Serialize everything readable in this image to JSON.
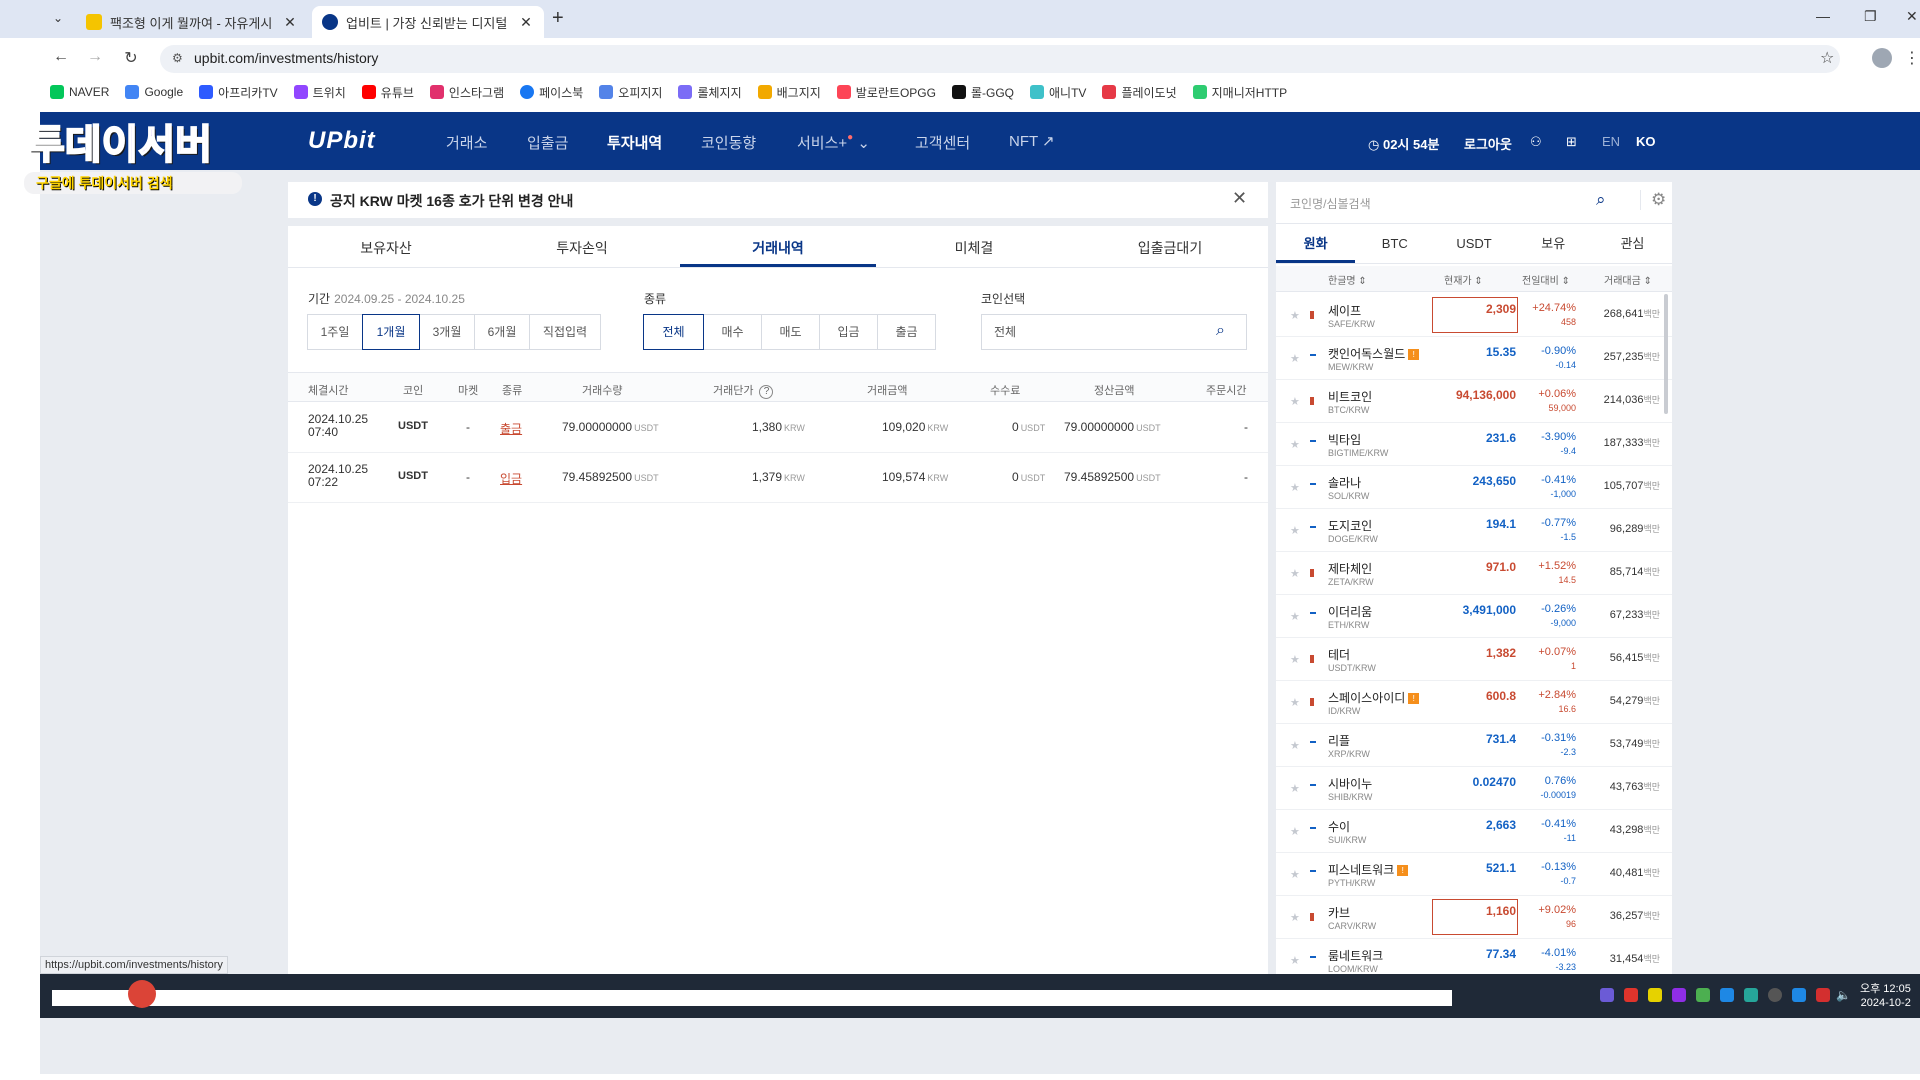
{
  "browser": {
    "tabs": [
      {
        "title": "팩조형 이게 뭘까여 - 자유게시",
        "favicon_color": "#f5c400"
      },
      {
        "title": "업비트 | 가장 신뢰받는 디지털",
        "favicon_color": "#093687"
      }
    ],
    "url": "upbit.com/investments/history",
    "bookmarks": [
      {
        "label": "NAVER",
        "color": "#03c75a"
      },
      {
        "label": "Google",
        "color": "#4285f4"
      },
      {
        "label": "아프리카TV",
        "color": "#2e5bff"
      },
      {
        "label": "트위치",
        "color": "#9146ff"
      },
      {
        "label": "유튜브",
        "color": "#ff0000"
      },
      {
        "label": "인스타그램",
        "color": "#e1306c"
      },
      {
        "label": "페이스북",
        "color": "#1877f2"
      },
      {
        "label": "오피지지",
        "color": "#5383e8"
      },
      {
        "label": "롤체지지",
        "color": "#7b6cf6"
      },
      {
        "label": "배그지지",
        "color": "#f2a900"
      },
      {
        "label": "발로란트OPGG",
        "color": "#fd4556"
      },
      {
        "label": "롤-GGQ",
        "color": "#111111"
      },
      {
        "label": "애니TV",
        "color": "#3fc1c9"
      },
      {
        "label": "플레이도넛",
        "color": "#e63946"
      },
      {
        "label": "지매니저HTTP",
        "color": "#2ecc71"
      }
    ]
  },
  "overlay": {
    "big": "투데이서버",
    "small": "구글에 투데이서버 검색"
  },
  "header": {
    "logo": "UPbit",
    "nav": [
      "거래소",
      "입출금",
      "투자내역",
      "코인동향",
      "서비스+",
      "고객센터",
      "NFT ↗"
    ],
    "session_timer": "02시 54분",
    "logout": "로그아웃",
    "lang_en": "EN",
    "lang_ko": "KO"
  },
  "notice": {
    "text": "공지 KRW 마켓 16종 호가 단위 변경 안내"
  },
  "tabs": [
    "보유자산",
    "투자손익",
    "거래내역",
    "미체결",
    "입출금대기"
  ],
  "filters": {
    "period_label": "기간",
    "period_range": "2024.09.25 - 2024.10.25",
    "period_options": [
      "1주일",
      "1개월",
      "3개월",
      "6개월",
      "직접입력"
    ],
    "type_label": "종류",
    "type_options": [
      "전체",
      "매수",
      "매도",
      "입금",
      "출금"
    ],
    "coin_label": "코인선택",
    "coin_value": "전체"
  },
  "table": {
    "headers": [
      "체결시간",
      "코인",
      "마켓",
      "종류",
      "거래수량",
      "거래단가",
      "거래금액",
      "수수료",
      "정산금액",
      "주문시간"
    ],
    "rows": [
      {
        "date": "2024.10.25",
        "time": "07:40",
        "coin": "USDT",
        "market": "-",
        "kind": "출금",
        "qty": "79.00000000",
        "qty_unit": "USDT",
        "price": "1,380",
        "price_unit": "KRW",
        "amount": "109,020",
        "amount_unit": "KRW",
        "fee": "0",
        "fee_unit": "USDT",
        "settle": "79.00000000",
        "settle_unit": "USDT",
        "order_time": "-"
      },
      {
        "date": "2024.10.25",
        "time": "07:22",
        "coin": "USDT",
        "market": "-",
        "kind": "입금",
        "qty": "79.45892500",
        "qty_unit": "USDT",
        "price": "1,379",
        "price_unit": "KRW",
        "amount": "109,574",
        "amount_unit": "KRW",
        "fee": "0",
        "fee_unit": "USDT",
        "settle": "79.45892500",
        "settle_unit": "USDT",
        "order_time": "-"
      }
    ]
  },
  "market": {
    "search_placeholder": "코인명/심볼검색",
    "tabs": [
      "원화",
      "BTC",
      "USDT",
      "보유",
      "관심"
    ],
    "headers": [
      "한글명 ⇕",
      "현재가 ⇕",
      "전일대비 ⇕",
      "거래대금 ⇕"
    ],
    "vol_unit": "백만",
    "coins": [
      {
        "name": "세이프",
        "symbol": "SAFE/KRW",
        "price": "2,309",
        "pct": "+24.74%",
        "diff": "458",
        "vol": "268,641",
        "dir": "up",
        "boxed": true,
        "badge": false
      },
      {
        "name": "캣인어독스월드",
        "symbol": "MEW/KRW",
        "price": "15.35",
        "pct": "-0.90%",
        "diff": "-0.14",
        "vol": "257,235",
        "dir": "dn",
        "boxed": false,
        "badge": true
      },
      {
        "name": "비트코인",
        "symbol": "BTC/KRW",
        "price": "94,136,000",
        "pct": "+0.06%",
        "diff": "59,000",
        "vol": "214,036",
        "dir": "up",
        "boxed": false,
        "badge": false
      },
      {
        "name": "빅타임",
        "symbol": "BIGTIME/KRW",
        "price": "231.6",
        "pct": "-3.90%",
        "diff": "-9.4",
        "vol": "187,333",
        "dir": "dn",
        "boxed": false,
        "badge": false
      },
      {
        "name": "솔라나",
        "symbol": "SOL/KRW",
        "price": "243,650",
        "pct": "-0.41%",
        "diff": "-1,000",
        "vol": "105,707",
        "dir": "dn",
        "boxed": false,
        "badge": false
      },
      {
        "name": "도지코인",
        "symbol": "DOGE/KRW",
        "price": "194.1",
        "pct": "-0.77%",
        "diff": "-1.5",
        "vol": "96,289",
        "dir": "dn",
        "boxed": false,
        "badge": false
      },
      {
        "name": "제타체인",
        "symbol": "ZETA/KRW",
        "price": "971.0",
        "pct": "+1.52%",
        "diff": "14.5",
        "vol": "85,714",
        "dir": "up",
        "boxed": false,
        "badge": false
      },
      {
        "name": "이더리움",
        "symbol": "ETH/KRW",
        "price": "3,491,000",
        "pct": "-0.26%",
        "diff": "-9,000",
        "vol": "67,233",
        "dir": "dn",
        "boxed": false,
        "badge": false
      },
      {
        "name": "테더",
        "symbol": "USDT/KRW",
        "price": "1,382",
        "pct": "+0.07%",
        "diff": "1",
        "vol": "56,415",
        "dir": "up",
        "boxed": false,
        "badge": false
      },
      {
        "name": "스페이스아이디",
        "symbol": "ID/KRW",
        "price": "600.8",
        "pct": "+2.84%",
        "diff": "16.6",
        "vol": "54,279",
        "dir": "up",
        "boxed": false,
        "badge": true
      },
      {
        "name": "리플",
        "symbol": "XRP/KRW",
        "price": "731.4",
        "pct": "-0.31%",
        "diff": "-2.3",
        "vol": "53,749",
        "dir": "dn",
        "boxed": false,
        "badge": false
      },
      {
        "name": "시바이누",
        "symbol": "SHIB/KRW",
        "price": "0.02470",
        "pct": "0.76%",
        "diff": "-0.00019",
        "vol": "43,763",
        "dir": "dn",
        "boxed": false,
        "badge": false
      },
      {
        "name": "수이",
        "symbol": "SUI/KRW",
        "price": "2,663",
        "pct": "-0.41%",
        "diff": "-11",
        "vol": "43,298",
        "dir": "dn",
        "boxed": false,
        "badge": false
      },
      {
        "name": "피스네트워크",
        "symbol": "PYTH/KRW",
        "price": "521.1",
        "pct": "-0.13%",
        "diff": "-0.7",
        "vol": "40,481",
        "dir": "dn",
        "boxed": false,
        "badge": true
      },
      {
        "name": "카브",
        "symbol": "CARV/KRW",
        "price": "1,160",
        "pct": "+9.02%",
        "diff": "96",
        "vol": "36,257",
        "dir": "up",
        "boxed": true,
        "badge": false
      },
      {
        "name": "룸네트워크",
        "symbol": "LOOM/KRW",
        "price": "77.34",
        "pct": "-4.01%",
        "diff": "-3.23",
        "vol": "31,454",
        "dir": "dn",
        "boxed": false,
        "badge": false
      }
    ]
  },
  "status_url": "https://upbit.com/investments/history",
  "taskbar": {
    "time": "오후 12:05",
    "date": "2024-10-2"
  }
}
